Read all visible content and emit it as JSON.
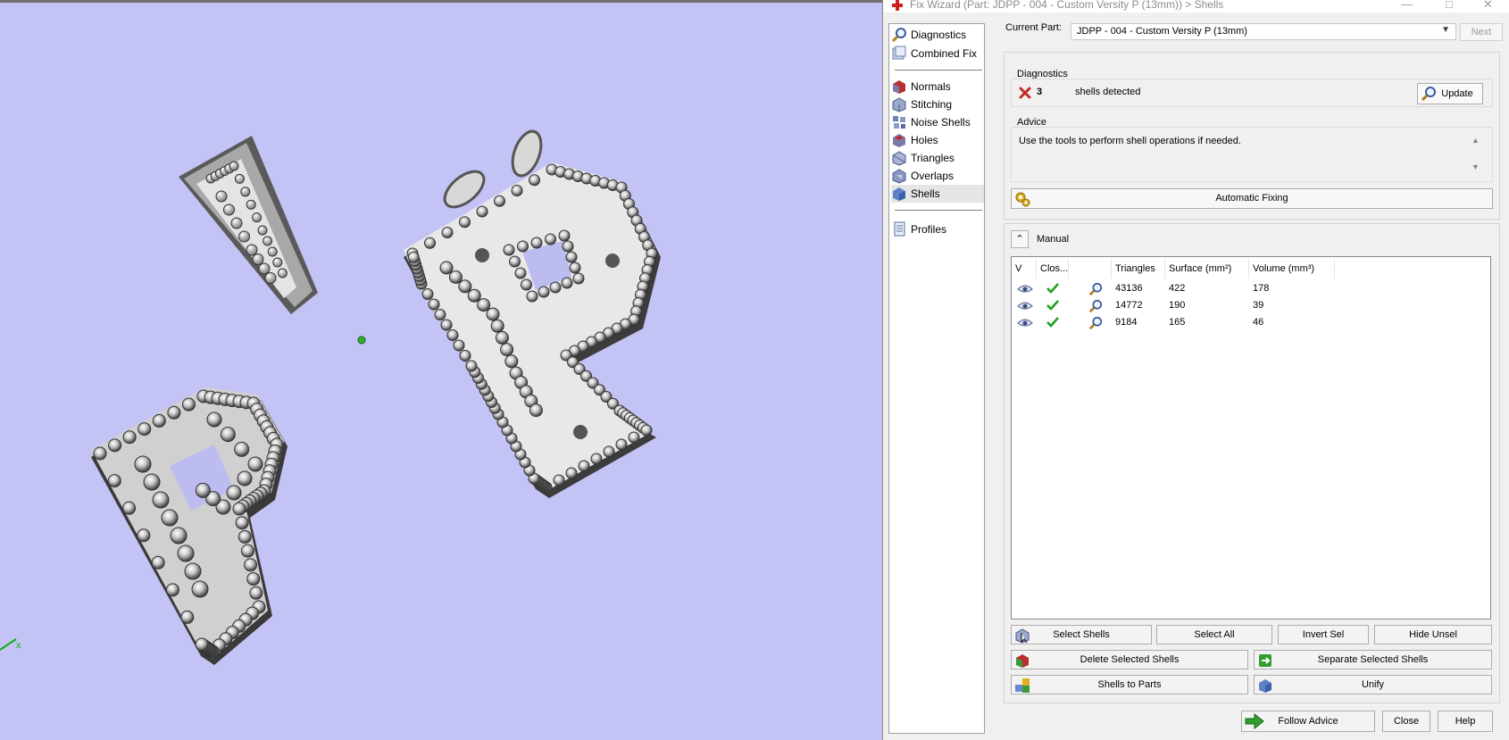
{
  "window_title": "Fix Wizard (Part: JDPP - 004 - Custom Versity P  (13mm)) > Shells",
  "nav": {
    "top_items": [
      {
        "label": "Diagnostics",
        "icon": "magnifier-icon"
      },
      {
        "label": "Combined Fix",
        "icon": "combined-fix-icon"
      }
    ],
    "tool_items": [
      {
        "label": "Normals",
        "icon": "normals-icon"
      },
      {
        "label": "Stitching",
        "icon": "stitching-icon"
      },
      {
        "label": "Noise Shells",
        "icon": "noise-shells-icon"
      },
      {
        "label": "Holes",
        "icon": "holes-icon"
      },
      {
        "label": "Triangles",
        "icon": "triangles-icon"
      },
      {
        "label": "Overlaps",
        "icon": "overlaps-icon"
      },
      {
        "label": "Shells",
        "icon": "shells-icon",
        "active": true
      }
    ],
    "profiles_label": "Profiles"
  },
  "current_part": {
    "label": "Current Part:",
    "value": "JDPP - 004 - Custom Versity P  (13mm)",
    "next_label": "Next"
  },
  "diagnostics": {
    "title": "Diagnostics",
    "count": "3",
    "message": "shells detected",
    "update_label": "Update",
    "status_color": "#d02020"
  },
  "advice": {
    "title": "Advice",
    "text": "Use the tools to perform shell operations if needed."
  },
  "automatic_fixing_label": "Automatic Fixing",
  "manual": {
    "label": "Manual",
    "columns": [
      "V",
      "Clos...",
      "",
      "Triangles",
      "Surface (mm²)",
      "Volume (mm³)"
    ],
    "rows": [
      {
        "closed": true,
        "triangles": "43136",
        "surface": "422",
        "volume": "178"
      },
      {
        "closed": true,
        "triangles": "14772",
        "surface": "190",
        "volume": "39"
      },
      {
        "closed": true,
        "triangles": "9184",
        "surface": "165",
        "volume": "46"
      }
    ]
  },
  "buttons": {
    "select_shells": "Select Shells",
    "select_all": "Select All",
    "invert_sel": "Invert Sel",
    "hide_unsel": "Hide Unsel",
    "delete_selected": "Delete Selected Shells",
    "separate_selected": "Separate Selected Shells",
    "shells_to_parts": "Shells to Parts",
    "unify": "Unify",
    "follow_advice": "Follow Advice",
    "close": "Close",
    "help": "Help"
  },
  "colors": {
    "viewport_bg": "#c3c3f5",
    "check_green": "#1aa11a",
    "accent_green": "#2f9e2f"
  }
}
